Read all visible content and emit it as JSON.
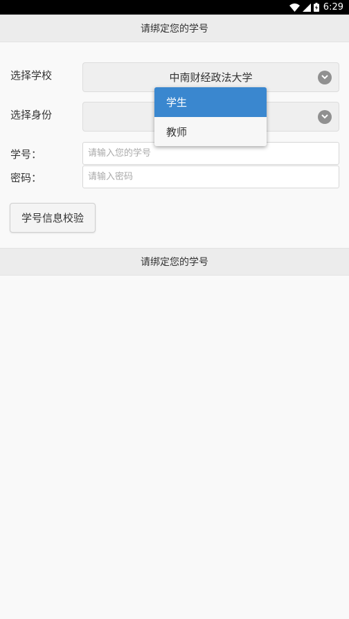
{
  "status_bar": {
    "time": "6:29"
  },
  "header": {
    "title": "请绑定您的学号"
  },
  "form": {
    "school_label": "选择学校",
    "school_value": "中南财经政法大学",
    "identity_label": "选择身份",
    "student_id_label": "学号：",
    "student_id_placeholder": "请输入您的学号",
    "password_label": "密码：",
    "password_placeholder": "请输入密码",
    "verify_button": "学号信息校验"
  },
  "identity_dropdown": {
    "options": [
      {
        "label": "学生",
        "selected": true
      },
      {
        "label": "教师",
        "selected": false
      }
    ]
  },
  "footer_header": {
    "title": "请绑定您的学号"
  },
  "colors": {
    "selected_option": "#3a87cf",
    "header_bg": "#ececec",
    "page_bg": "#f9f9f9"
  }
}
